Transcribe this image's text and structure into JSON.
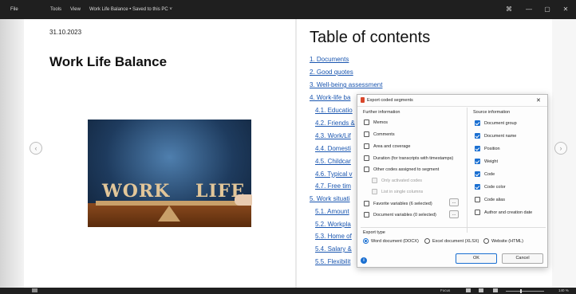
{
  "titlebar": {
    "menu": [
      "File",
      "Tools",
      "View"
    ],
    "doc_title": "Work Life Balance • Saved to this PC ˅",
    "focus_icon": "⌘",
    "minimize": "—",
    "maximize": "▢",
    "close": "✕"
  },
  "page1": {
    "date": "31.10.2023",
    "title": "Work Life Balance",
    "cover_words": [
      "WORK",
      "LIFE"
    ]
  },
  "toc": {
    "title": "Table of contents",
    "items": [
      "1. Documents",
      "2. Good quotes",
      "3. Well-being assessment",
      "4. Work-life ba",
      "4.1. Educatio",
      "4.2. Friends &",
      "4.3. Work/Lif",
      "4.4. Domesti",
      "4.5. Childcar",
      "4.6. Typical v",
      "4.7. Free tim",
      "5. Work situati",
      "5.1. Amount",
      "5.2. Workpla",
      "5.3. Home of",
      "5.4. Salary &",
      "5.5. Flexibilit"
    ]
  },
  "dialog": {
    "title": "Export coded segments",
    "further_heading": "Further information",
    "further": [
      {
        "label": "Memos",
        "checked": false
      },
      {
        "label": "Comments",
        "checked": false
      },
      {
        "label": "Area and coverage",
        "checked": false
      },
      {
        "label": "Duration (for transcripts with timestamps)",
        "checked": false
      },
      {
        "label": "Other codes assigned to segment",
        "checked": false
      }
    ],
    "sub_options": [
      {
        "label": "Only activated codes",
        "checked": false
      },
      {
        "label": "List in single columns",
        "checked": false
      }
    ],
    "favorite_vars": "Favorite variables (6 selected)",
    "document_vars": "Document variables (0 selected)",
    "ellipsis": "...",
    "source_heading": "Source information",
    "source": [
      {
        "label": "Document group",
        "checked": true
      },
      {
        "label": "Document name",
        "checked": true
      },
      {
        "label": "Position",
        "checked": true
      },
      {
        "label": "Weight",
        "checked": true
      },
      {
        "label": "Code",
        "checked": true
      },
      {
        "label": "Code color",
        "checked": true
      },
      {
        "label": "Code alias",
        "checked": false
      },
      {
        "label": "Author and creation date",
        "checked": false
      }
    ],
    "export_heading": "Export type",
    "export_types": [
      {
        "label": "Word document (DOCX)",
        "selected": true
      },
      {
        "label": "Excel document (XLSX)",
        "selected": false
      },
      {
        "label": "Website (HTML)",
        "selected": false
      }
    ],
    "ok": "OK",
    "cancel": "Cancel",
    "info_icon": "i",
    "close_icon": "✕"
  },
  "nav": {
    "prev": "‹",
    "next": "›"
  },
  "statusbar": {
    "focus": "Focus",
    "zoom": "140 %"
  }
}
